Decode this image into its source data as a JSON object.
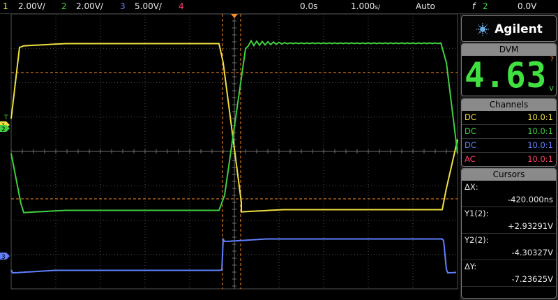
{
  "topbar": {
    "ch1": {
      "num": "1",
      "scale": "2.00V/"
    },
    "ch2": {
      "num": "2",
      "scale": "2.00V/"
    },
    "ch3": {
      "num": "3",
      "scale": "5.00V/"
    },
    "ch4": {
      "num": "4"
    },
    "time_position": "0.0s",
    "time_scale": "1.000",
    "time_scale_unit": "s/",
    "trigger_mode": "Auto",
    "trigger_slope_symbol": "f",
    "trigger_source": "2",
    "trigger_level": "0.0V"
  },
  "brand": "Agilent",
  "dvm": {
    "header": "DVM",
    "value": "4.63",
    "unit": "V",
    "flag": "?"
  },
  "channels": {
    "header": "Channels",
    "items": [
      {
        "coupling": "DC",
        "probe": "10.0:1",
        "color": "#f0e040"
      },
      {
        "coupling": "DC",
        "probe": "10.0:1",
        "color": "#40d040"
      },
      {
        "coupling": "DC",
        "probe": "10.0:1",
        "color": "#6080ff"
      },
      {
        "coupling": "AC",
        "probe": "10.0:1",
        "color": "#ff4070"
      }
    ]
  },
  "cursors": {
    "header": "Cursors",
    "items": [
      {
        "label": "ΔX:",
        "value": "-420.000ns"
      },
      {
        "label": "Y1(2):",
        "value": "+2.93291V"
      },
      {
        "label": "Y2(2):",
        "value": "-4.30327V"
      },
      {
        "label": "ΔY:",
        "value": "-7.23625V"
      }
    ]
  },
  "markers": {
    "ch1": "1",
    "ch2": "2",
    "ch3": "3",
    "trigger": "T"
  },
  "colors": {
    "ch1": "#f0e040",
    "ch2": "#40d040",
    "ch3": "#6080ff",
    "ch4": "#ff4070",
    "cursor": "#ff8c20",
    "grid": "#505050"
  }
}
